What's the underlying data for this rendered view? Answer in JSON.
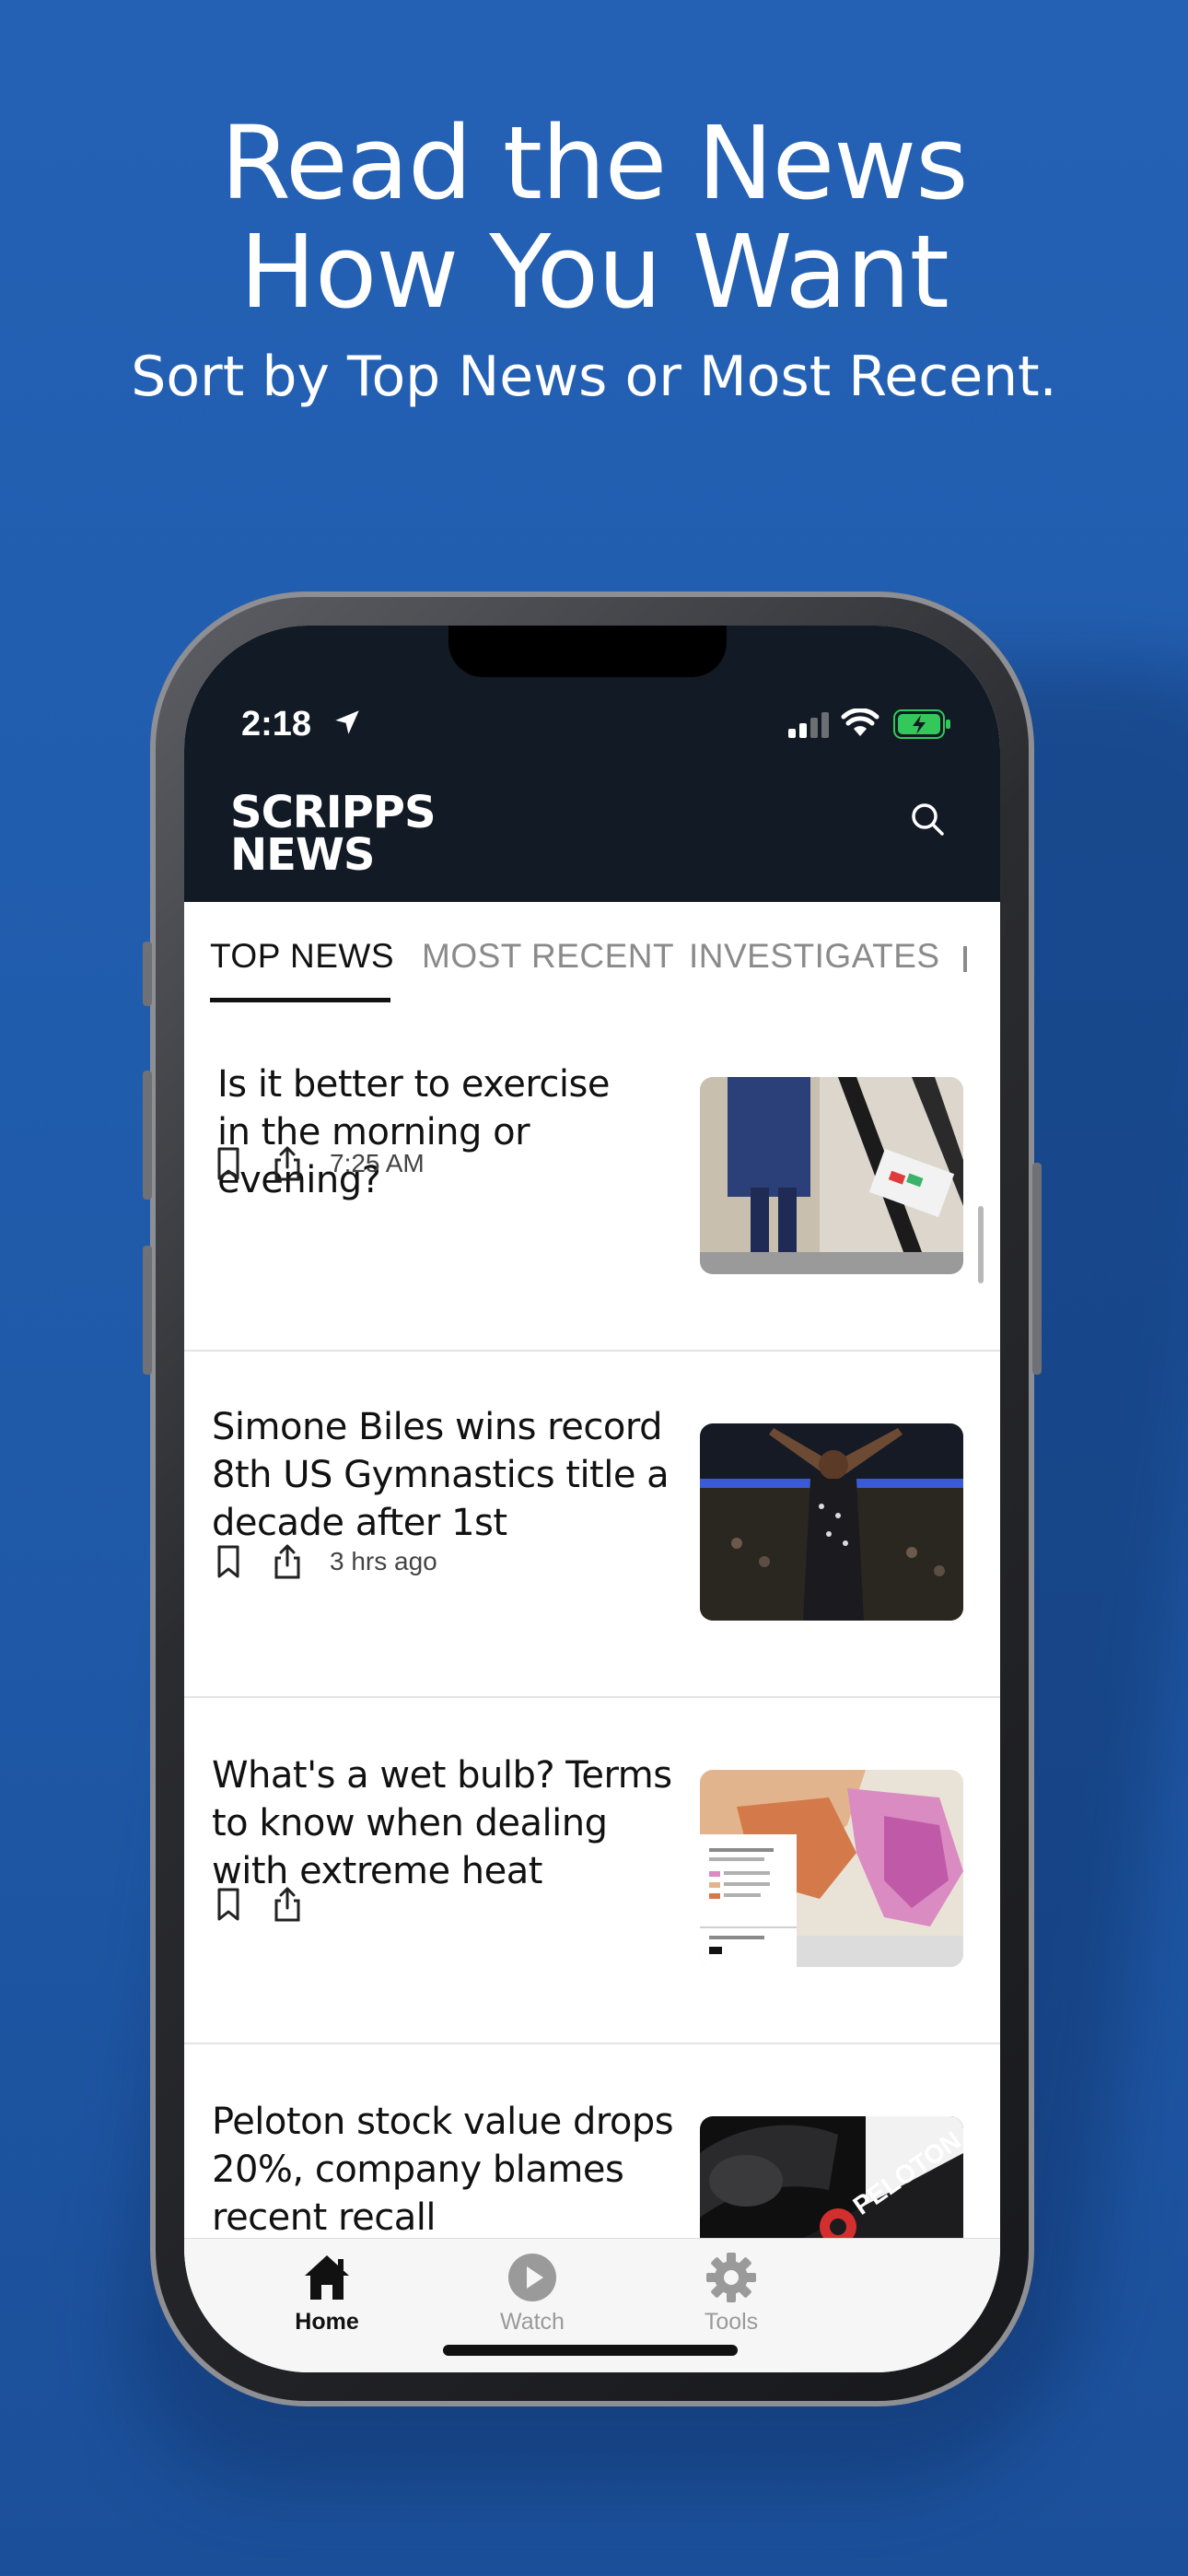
{
  "promo": {
    "headline_line1": "Read the News",
    "headline_line2": "How You Want",
    "subheadline": "Sort by Top News or Most Recent."
  },
  "status_bar": {
    "time": "2:18"
  },
  "header": {
    "logo_line1": "SCRIPPS",
    "logo_line2": "NEWS"
  },
  "tabs": [
    {
      "label": "TOP NEWS",
      "active": true
    },
    {
      "label": "MOST RECENT",
      "active": false
    },
    {
      "label": "INVESTIGATES",
      "active": false
    }
  ],
  "articles": [
    {
      "title": "Is it better to exercise in the morning or evening?",
      "timestamp": "7:25 AM"
    },
    {
      "title": "Simone Biles wins record 8th US Gymnastics title a decade after 1st",
      "timestamp": "3 hrs ago"
    },
    {
      "title": "What's a wet bulb? Terms to know when dealing with extreme heat",
      "timestamp": ""
    },
    {
      "title": "Peloton stock value drops 20%, company blames recent recall",
      "timestamp": ""
    }
  ],
  "thumb_text": {
    "peloton_brand": "PELOTON"
  },
  "bottom_nav": [
    {
      "label": "Home",
      "icon": "home-icon",
      "active": true
    },
    {
      "label": "Watch",
      "icon": "play-icon",
      "active": false
    },
    {
      "label": "Tools",
      "icon": "gear-icon",
      "active": false
    }
  ],
  "colors": {
    "background": "#2461b5",
    "header": "#121a25",
    "battery": "#34c759"
  }
}
